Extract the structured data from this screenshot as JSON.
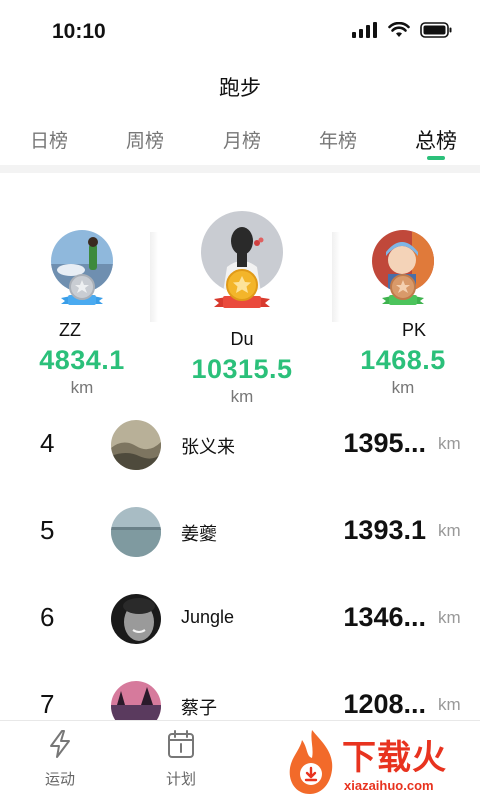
{
  "status_bar": {
    "time": "10:10"
  },
  "header": {
    "title": "跑步"
  },
  "tabs": [
    {
      "label": "日榜"
    },
    {
      "label": "周榜"
    },
    {
      "label": "月榜"
    },
    {
      "label": "年榜"
    },
    {
      "label": "总榜",
      "active": true
    }
  ],
  "podium": {
    "second": {
      "name": "ZZ",
      "value": "4834.1",
      "unit": "km",
      "medal": "NO.2"
    },
    "first": {
      "name": "Du",
      "value": "10315.5",
      "unit": "km",
      "medal": "NO.1"
    },
    "third": {
      "name": "PK",
      "value": "1468.5",
      "unit": "km",
      "medal": "NO.3"
    }
  },
  "ranking": [
    {
      "rank": "4",
      "name": "张义来",
      "value": "1395...",
      "unit": "km"
    },
    {
      "rank": "5",
      "name": "姜夔",
      "value": "1393.1",
      "unit": "km"
    },
    {
      "rank": "6",
      "name": "Jungle",
      "value": "1346...",
      "unit": "km"
    },
    {
      "rank": "7",
      "name": "蔡子",
      "value": "1208...",
      "unit": "km"
    }
  ],
  "bottom_nav": [
    {
      "label": "运动",
      "icon": "lightning-icon"
    },
    {
      "label": "计划",
      "icon": "calendar-icon"
    }
  ],
  "watermark": {
    "text": "下载火",
    "url": "xiazaihuo.com"
  },
  "colors": {
    "accent": "#2bc07a",
    "watermark": "#e8331f"
  }
}
